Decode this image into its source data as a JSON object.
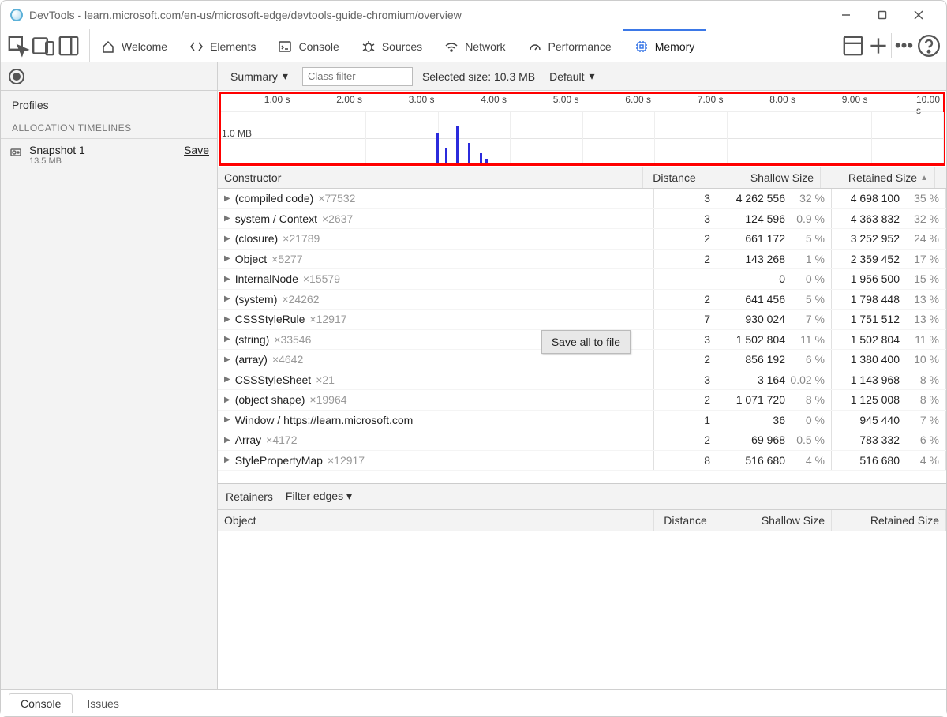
{
  "window": {
    "title": "DevTools - learn.microsoft.com/en-us/microsoft-edge/devtools-guide-chromium/overview"
  },
  "tabs": [
    {
      "label": "Welcome"
    },
    {
      "label": "Elements"
    },
    {
      "label": "Console"
    },
    {
      "label": "Sources"
    },
    {
      "label": "Network"
    },
    {
      "label": "Performance"
    },
    {
      "label": "Memory",
      "active": true
    }
  ],
  "toolbar": {
    "summary_label": "Summary",
    "filter_placeholder": "Class filter",
    "selected_size_label": "Selected size: 10.3 MB",
    "default_label": "Default"
  },
  "sidebar": {
    "profiles_label": "Profiles",
    "timelines_label": "ALLOCATION TIMELINES",
    "snapshot": {
      "name": "Snapshot 1",
      "size": "13.5 MB",
      "save_label": "Save"
    }
  },
  "timeline": {
    "ticks": [
      "1.00 s",
      "2.00 s",
      "3.00 s",
      "4.00 s",
      "5.00 s",
      "6.00 s",
      "7.00 s",
      "8.00 s",
      "9.00 s",
      "10.00 s"
    ],
    "ylabel": "1.0 MB",
    "bars": [
      {
        "left_pct": 29.8,
        "height_pct": 58
      },
      {
        "left_pct": 31.0,
        "height_pct": 30
      },
      {
        "left_pct": 32.6,
        "height_pct": 72
      },
      {
        "left_pct": 34.2,
        "height_pct": 40
      },
      {
        "left_pct": 35.8,
        "height_pct": 20
      },
      {
        "left_pct": 36.6,
        "height_pct": 10
      }
    ]
  },
  "table": {
    "headers": {
      "constructor": "Constructor",
      "distance": "Distance",
      "shallow": "Shallow Size",
      "retained": "Retained Size"
    },
    "rows": [
      {
        "name": "(compiled code)",
        "count": "×77532",
        "distance": "3",
        "shallow": "4 262 556",
        "shallow_pct": "32 %",
        "retained": "4 698 100",
        "retained_pct": "35 %"
      },
      {
        "name": "system / Context",
        "count": "×2637",
        "distance": "3",
        "shallow": "124 596",
        "shallow_pct": "0.9 %",
        "retained": "4 363 832",
        "retained_pct": "32 %"
      },
      {
        "name": "(closure)",
        "count": "×21789",
        "distance": "2",
        "shallow": "661 172",
        "shallow_pct": "5 %",
        "retained": "3 252 952",
        "retained_pct": "24 %"
      },
      {
        "name": "Object",
        "count": "×5277",
        "distance": "2",
        "shallow": "143 268",
        "shallow_pct": "1 %",
        "retained": "2 359 452",
        "retained_pct": "17 %"
      },
      {
        "name": "InternalNode",
        "count": "×15579",
        "distance": "–",
        "shallow": "0",
        "shallow_pct": "0 %",
        "retained": "1 956 500",
        "retained_pct": "15 %"
      },
      {
        "name": "(system)",
        "count": "×24262",
        "distance": "2",
        "shallow": "641 456",
        "shallow_pct": "5 %",
        "retained": "1 798 448",
        "retained_pct": "13 %"
      },
      {
        "name": "CSSStyleRule",
        "count": "×12917",
        "distance": "7",
        "shallow": "930 024",
        "shallow_pct": "7 %",
        "retained": "1 751 512",
        "retained_pct": "13 %"
      },
      {
        "name": "(string)",
        "count": "×33546",
        "distance": "3",
        "shallow": "1 502 804",
        "shallow_pct": "11 %",
        "retained": "1 502 804",
        "retained_pct": "11 %"
      },
      {
        "name": "(array)",
        "count": "×4642",
        "distance": "2",
        "shallow": "856 192",
        "shallow_pct": "6 %",
        "retained": "1 380 400",
        "retained_pct": "10 %"
      },
      {
        "name": "CSSStyleSheet",
        "count": "×21",
        "distance": "3",
        "shallow": "3 164",
        "shallow_pct": "0.02 %",
        "retained": "1 143 968",
        "retained_pct": "8 %"
      },
      {
        "name": "(object shape)",
        "count": "×19964",
        "distance": "2",
        "shallow": "1 071 720",
        "shallow_pct": "8 %",
        "retained": "1 125 008",
        "retained_pct": "8 %"
      },
      {
        "name": "Window / https://learn.microsoft.com",
        "count": "",
        "distance": "1",
        "shallow": "36",
        "shallow_pct": "0 %",
        "retained": "945 440",
        "retained_pct": "7 %"
      },
      {
        "name": "Array",
        "count": "×4172",
        "distance": "2",
        "shallow": "69 968",
        "shallow_pct": "0.5 %",
        "retained": "783 332",
        "retained_pct": "6 %"
      },
      {
        "name": "StylePropertyMap",
        "count": "×12917",
        "distance": "8",
        "shallow": "516 680",
        "shallow_pct": "4 %",
        "retained": "516 680",
        "retained_pct": "4 %"
      }
    ],
    "context_menu": "Save all to file"
  },
  "retainers": {
    "label": "Retainers",
    "filter_label": "Filter edges",
    "headers": {
      "object": "Object",
      "distance": "Distance",
      "shallow": "Shallow Size",
      "retained": "Retained Size"
    }
  },
  "footer": {
    "console": "Console",
    "issues": "Issues"
  }
}
